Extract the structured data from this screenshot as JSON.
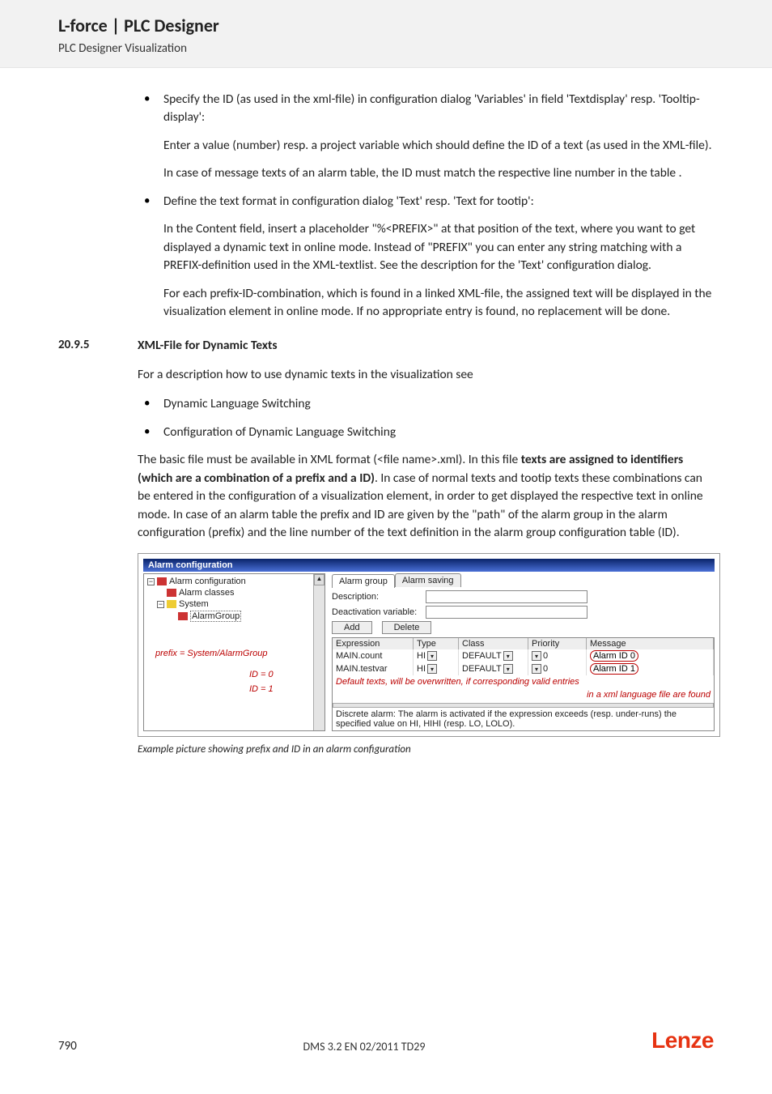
{
  "header": {
    "title": "L-force | PLC Designer",
    "subtitle": "PLC Designer Visualization"
  },
  "bullets1": [
    {
      "lead": "Specify the ID (as used in the xml-file) in configuration dialog 'Variables' in field 'Textdisplay' resp. 'Tooltip-display':",
      "p1": "Enter a value (number) resp. a project variable which should define the ID of a text (as used in the XML-file).",
      "p2": "In case of message texts of an alarm table, the ID must match the respective line number in the table ."
    },
    {
      "lead": "Define the text format in configuration dialog 'Text' resp. 'Text for tootip':",
      "p1": "In the Content field, insert a placeholder \"%<PREFIX>\" at that position of the text, where you want to get displayed a dynamic text in online mode. Instead of \"PREFIX\" you can enter any string matching with a PREFIX-definition used in the XML-textlist. See the description for the 'Text' configuration dialog.",
      "p2": "For each prefix-ID-combination, which is found in a linked XML-file, the assigned text will be displayed in the visualization element in online mode. If no appropriate entry is found, no replacement will be done."
    }
  ],
  "section": {
    "num": "20.9.5",
    "title": "XML-File for Dynamic Texts",
    "intro": "For a description how to use dynamic texts in the visualization see",
    "list": [
      "Dynamic Language Switching",
      "Configuration of Dynamic Language Switching"
    ],
    "body_a": "The basic file must be available in XML format (<file name>.xml). In this file ",
    "body_bold": "texts are assigned to identifiers (which are a combination of a prefix and a ID)",
    "body_b": ". In case of normal texts and tootip texts these combinations can be entered in the configuration of a visualization element, in order to get displayed the respective text in online mode. In case of an alarm table the prefix and ID are given by the \"path\" of the alarm group in the alarm configuration (prefix) and the line number of the text definition in the alarm group configuration table (ID)."
  },
  "figure": {
    "titlebar": "Alarm configuration",
    "tree": {
      "root": "Alarm configuration",
      "n1": "Alarm classes",
      "n2": "System",
      "n3": "AlarmGroup",
      "anno_prefix": "prefix = System/AlarmGroup",
      "anno_id0": "ID = 0",
      "anno_id1": "ID = 1"
    },
    "tabs": {
      "t1": "Alarm group",
      "t2": "Alarm saving"
    },
    "labels": {
      "desc": "Description:",
      "deact": "Deactivation variable:"
    },
    "buttons": {
      "add": "Add",
      "del": "Delete"
    },
    "table": {
      "headers": {
        "exp": "Expression",
        "type": "Type",
        "class": "Class",
        "prio": "Priority",
        "msg": "Message"
      },
      "rows": [
        {
          "exp": "MAIN.count",
          "type": "HI",
          "class": "DEFAULT",
          "prio": "0",
          "msg": "Alarm ID 0"
        },
        {
          "exp": "MAIN.testvar",
          "type": "HI",
          "class": "DEFAULT",
          "prio": "0",
          "msg": "Alarm ID 1"
        }
      ],
      "note1": "Default texts, will be overwritten, if corresponding valid entries",
      "note2": "in a xml language file are found",
      "help": "Discrete alarm: The alarm is activated if the expression exceeds (resp. under-runs) the specified value on HI, HIHI (resp. LO, LOLO)."
    },
    "caption": "Example picture showing prefix and ID in an alarm configuration"
  },
  "footer": {
    "page": "790",
    "docid": "DMS 3.2 EN 02/2011 TD29",
    "logo": "Lenze"
  }
}
